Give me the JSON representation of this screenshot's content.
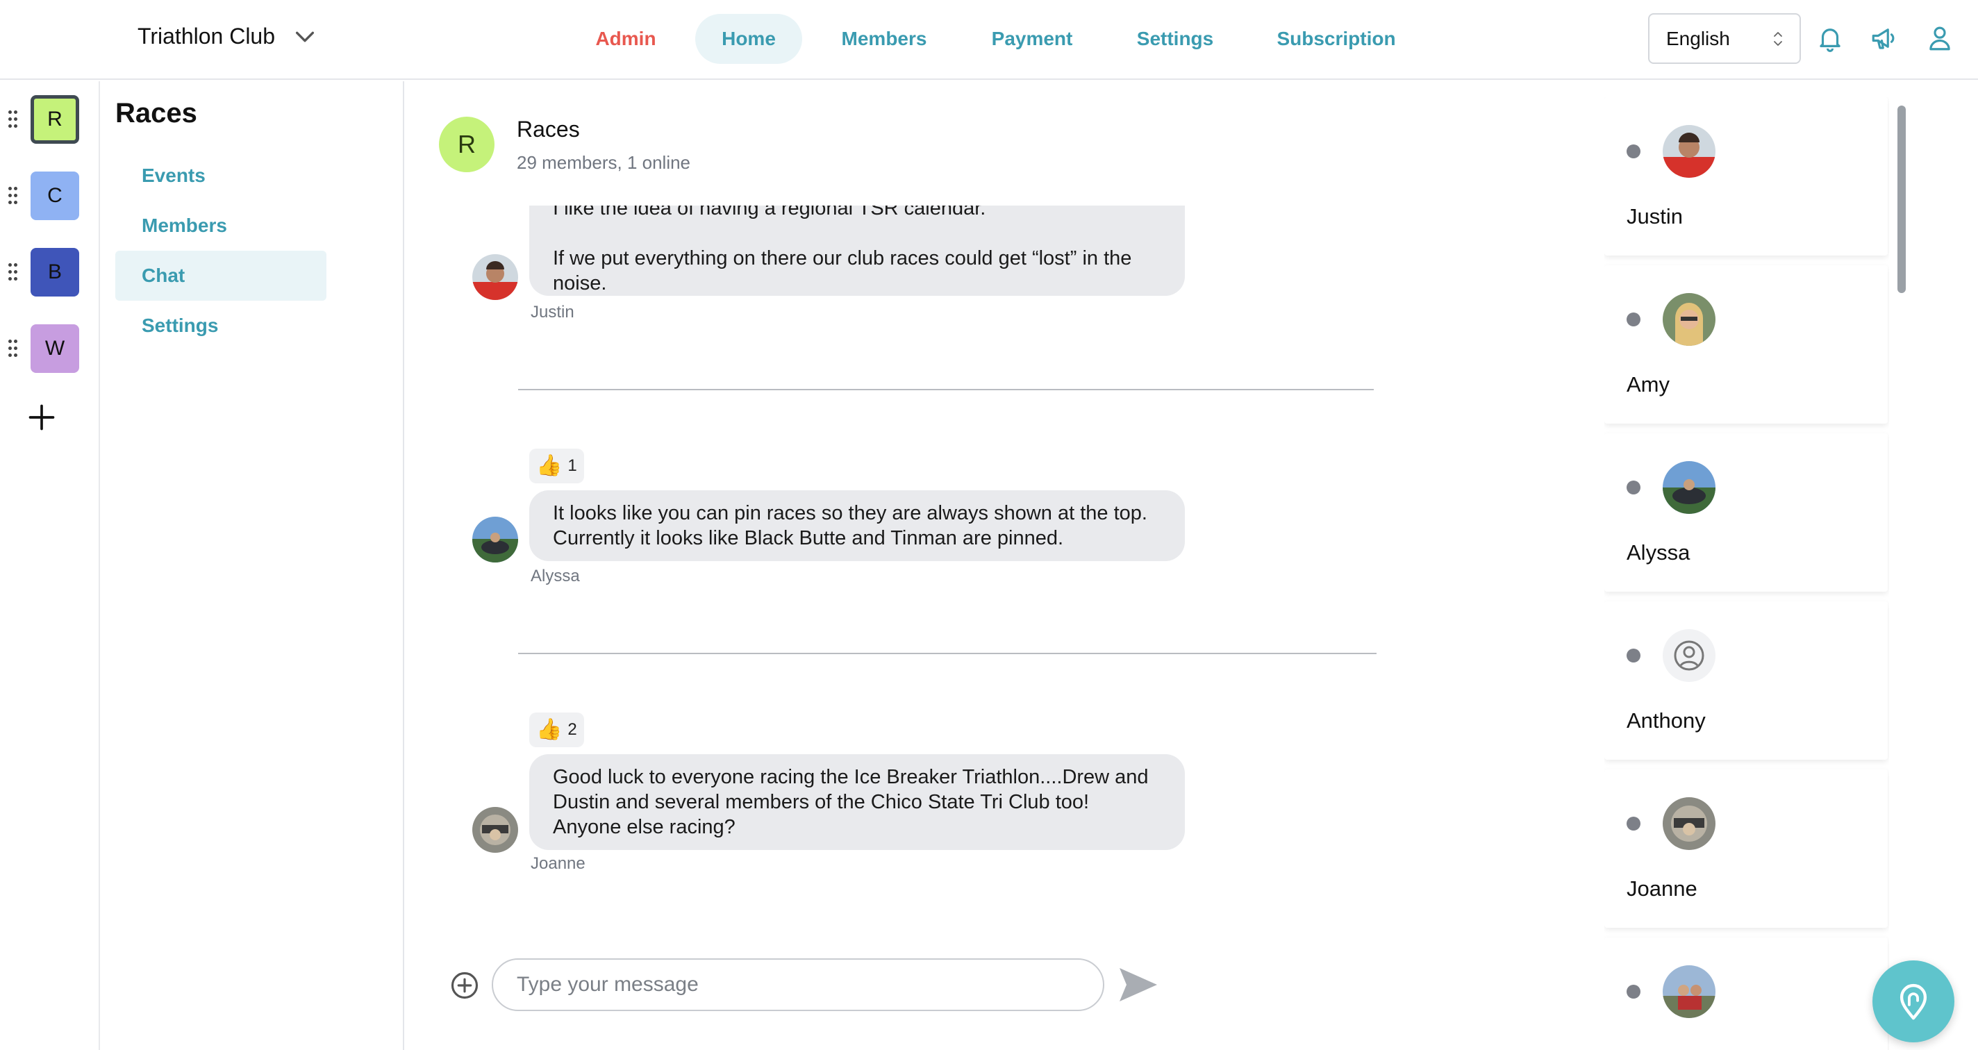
{
  "header": {
    "club_name": "Triathlon Club",
    "nav": [
      {
        "label": "Admin"
      },
      {
        "label": "Home"
      },
      {
        "label": "Members"
      },
      {
        "label": "Payment"
      },
      {
        "label": "Settings"
      },
      {
        "label": "Subscription"
      }
    ],
    "active_nav": "Home",
    "language": "English",
    "icons": [
      "bell-icon",
      "megaphone-icon",
      "user-icon"
    ],
    "colors": {
      "accent": "#3a9bb0",
      "admin": "#e8584f"
    }
  },
  "rail": {
    "groups": [
      {
        "letter": "R",
        "color": "#c5f27a",
        "selected": true
      },
      {
        "letter": "C",
        "color": "#8fb2f3",
        "selected": false
      },
      {
        "letter": "B",
        "color": "#3f55b9",
        "selected": false
      },
      {
        "letter": "W",
        "color": "#c79de0",
        "selected": false
      }
    ]
  },
  "group_sidebar": {
    "title": "Races",
    "links": [
      {
        "label": "Events"
      },
      {
        "label": "Members"
      },
      {
        "label": "Chat"
      },
      {
        "label": "Settings"
      }
    ],
    "active": "Chat"
  },
  "chat": {
    "avatar_letter": "R",
    "title": "Races",
    "subtitle": "29 members, 1 online",
    "messages": [
      {
        "sender": "Justin",
        "text_partial_top": "I like the idea of having a regional TSR calendar.",
        "text": "If we put everything on there our club races could get “lost” in the noise.",
        "reaction": null
      },
      {
        "sender": "Alyssa",
        "text": "It looks like you can pin races so they are always shown at the top. Currently it looks like Black Butte and Tinman are pinned.",
        "reaction": {
          "emoji": "👍",
          "count": "1"
        }
      },
      {
        "sender": "Joanne",
        "text": "Good luck to everyone racing the Ice Breaker Triathlon....Drew and Dustin and several members of the Chico State Tri Club too! Anyone else racing?",
        "reaction": {
          "emoji": "👍",
          "count": "2"
        }
      }
    ],
    "composer": {
      "placeholder": "Type your message"
    }
  },
  "members": [
    {
      "name": "Justin"
    },
    {
      "name": "Amy"
    },
    {
      "name": "Alyssa"
    },
    {
      "name": "Anthony"
    },
    {
      "name": "Joanne"
    },
    {
      "name": ""
    }
  ]
}
